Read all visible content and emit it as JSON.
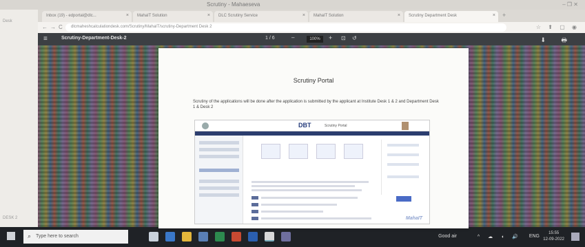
{
  "window": {
    "title": "Scrutiny - Mahaeseva",
    "controls": "–  ❐  ✕"
  },
  "tabs": [
    {
      "label": "Inbox (19) - edportal@dlc..."
    },
    {
      "label": "MahaIT Solution"
    },
    {
      "label": "DLC Scrutiny Service"
    },
    {
      "label": "MahaIT Solution"
    },
    {
      "label": "Scrutiny Department Desk"
    }
  ],
  "address": {
    "url": "dlcmaheshcalculationdesk.com/Scrutiny/MahaIT/scrutiny-Department Desk 2",
    "back": "←",
    "forward": "→",
    "reload": "C",
    "home": "⌂",
    "right_icons": "☆ ⬆ ▢ ◉"
  },
  "left_strip": {
    "top_label": "Desk",
    "bottom_label": "DESK 2"
  },
  "pdf_toolbar": {
    "menu_icon": "≡",
    "doc_title": "Scrutiny-Department-Desk-2",
    "page": "1 / 6",
    "zoom_out": "–",
    "zoom_value": "100%",
    "zoom_in": "+",
    "right": "⬇ 🖶"
  },
  "pdf_page": {
    "heading": "Scrutiny Portal",
    "body": "Scrutiny of the applications will be done after the application is submitted by the applicant at Institute Desk 1 & 2 and Department Desk 1 & Desk 2",
    "embedded": {
      "logo": "DBT",
      "subtitle": "Scrutiny Portal",
      "watermark": "MahaIT"
    }
  },
  "taskbar": {
    "search_placeholder": "Type here to search",
    "weather": "Good air",
    "lang": "ENG",
    "time": "15:55",
    "date": "12-09-2022"
  },
  "colors": {
    "taskbar": "#1f2226",
    "pdf_toolbar": "#3c3f43",
    "accent": "#2b3d6e"
  }
}
